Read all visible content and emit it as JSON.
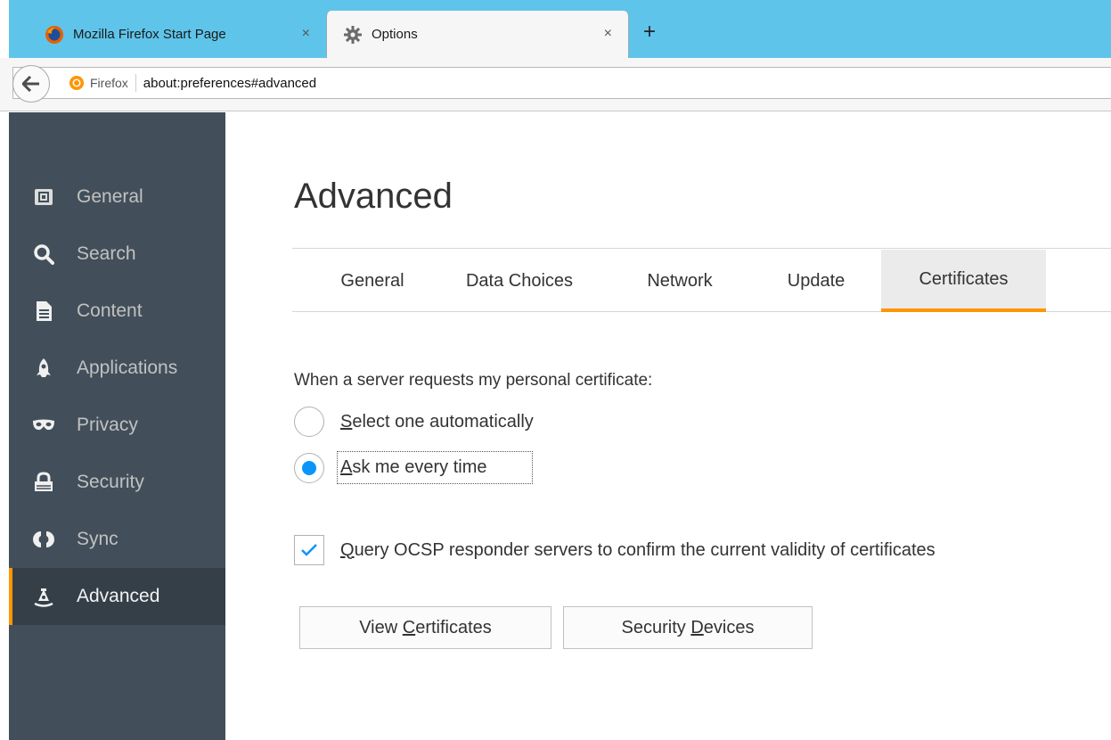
{
  "browser": {
    "tabs": [
      {
        "title": "Mozilla Firefox Start Page",
        "icon": "firefox-icon",
        "close": "×",
        "active": false
      },
      {
        "title": "Options",
        "icon": "gear-icon",
        "close": "×",
        "active": true
      }
    ],
    "new_tab": "+",
    "identity_label": "Firefox",
    "url": "about:preferences#advanced"
  },
  "sidebar": {
    "items": [
      {
        "label": "General",
        "icon": "general-icon"
      },
      {
        "label": "Search",
        "icon": "search-icon"
      },
      {
        "label": "Content",
        "icon": "content-icon"
      },
      {
        "label": "Applications",
        "icon": "applications-icon"
      },
      {
        "label": "Privacy",
        "icon": "privacy-mask-icon"
      },
      {
        "label": "Security",
        "icon": "security-lock-icon"
      },
      {
        "label": "Sync",
        "icon": "sync-icon"
      },
      {
        "label": "Advanced",
        "icon": "advanced-icon",
        "selected": true
      }
    ]
  },
  "main": {
    "title": "Advanced",
    "tabs": [
      {
        "label": "General"
      },
      {
        "label": "Data Choices"
      },
      {
        "label": "Network"
      },
      {
        "label": "Update"
      },
      {
        "label": "Certificates",
        "selected": true
      }
    ],
    "certificates": {
      "prompt": "When a server requests my personal certificate:",
      "radio_auto": {
        "accesskey": "S",
        "rest": "elect one automatically",
        "checked": false
      },
      "radio_ask": {
        "accesskey": "A",
        "rest": "sk me every time",
        "checked": true
      },
      "ocsp": {
        "accesskey": "Q",
        "rest": "uery OCSP responder servers to confirm the current validity of certificates",
        "checked": true
      },
      "view_button": {
        "pre": "View ",
        "accesskey": "C",
        "rest": "ertificates"
      },
      "devices_button": {
        "pre": "Security ",
        "accesskey": "D",
        "rest": "evices"
      }
    }
  },
  "colors": {
    "accent": "#ff9500",
    "sidebar_bg": "#424f5a",
    "sidebar_selected_bg": "#343f48",
    "tabstrip_bg": "#5fc4ea",
    "radio_dot": "#0996f8"
  }
}
